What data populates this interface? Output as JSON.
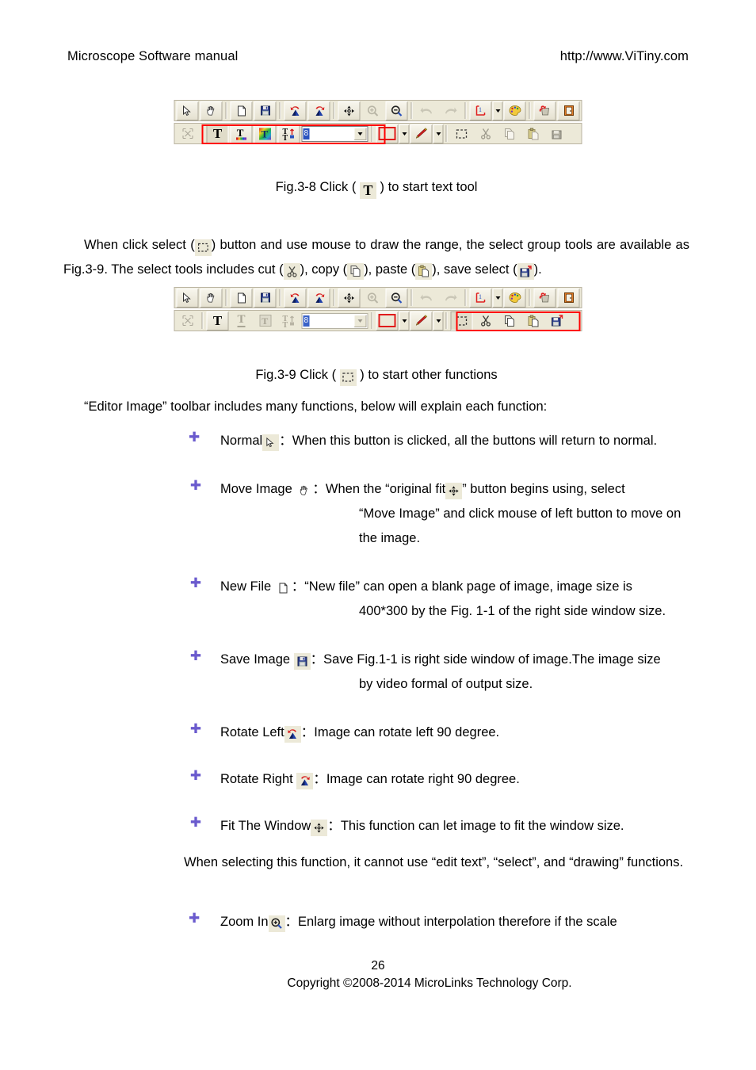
{
  "header": {
    "left": "Microscope Software manual",
    "right": "http://www.ViTiny.com"
  },
  "figures": [
    {
      "id": "fig-3-8",
      "caption_before": "Fig.3-8 Click (",
      "caption_icon": "text-tool-icon",
      "caption_after": ") to start text tool",
      "highlight": "text-tool-group"
    },
    {
      "id": "fig-3-9",
      "caption_before": "Fig.3-9 Click (",
      "caption_icon": "select-rectangle-icon",
      "caption_after": ") to start other functions",
      "highlight": "select-group"
    }
  ],
  "toolbar": {
    "row1": [
      {
        "name": "normal-cursor-button",
        "icon": "arrow-cursor-icon"
      },
      {
        "name": "move-image-button",
        "icon": "hand-icon"
      },
      {
        "name": "new-file-button",
        "icon": "new-page-icon"
      },
      {
        "name": "save-image-button",
        "icon": "floppy-disk-icon"
      },
      {
        "name": "rotate-left-button",
        "icon": "rotate-left-icon"
      },
      {
        "name": "rotate-right-button",
        "icon": "rotate-right-icon"
      },
      {
        "name": "fit-window-button",
        "icon": "fit-window-icon"
      },
      {
        "name": "zoom-in-button",
        "icon": "magnifier-plus-icon"
      },
      {
        "name": "zoom-out-button",
        "icon": "magnifier-minus-icon"
      },
      {
        "name": "undo-button",
        "icon": "undo-arrow-icon"
      },
      {
        "name": "redo-button",
        "icon": "redo-arrow-icon"
      },
      {
        "name": "measure-button",
        "icon": "measure-corner-icon"
      },
      {
        "name": "measure-dropdown",
        "icon": "chevron-down-icon"
      },
      {
        "name": "palette-button",
        "icon": "palette-icon"
      },
      {
        "name": "refresh-button",
        "icon": "recycle-bin-icon"
      },
      {
        "name": "exit-button",
        "icon": "exit-door-icon"
      }
    ],
    "row2": [
      {
        "name": "resize-button",
        "icon": "resize-arrows-icon"
      },
      {
        "name": "text-tool-button",
        "icon": "text-tool-icon"
      },
      {
        "name": "text-color-button",
        "icon": "text-rainbow-underline-icon"
      },
      {
        "name": "text-gradient-button",
        "icon": "text-gradient-icon"
      },
      {
        "name": "text-edit-button",
        "icon": "text-edit-icon"
      },
      {
        "name": "font-size-combo",
        "icon": "combo-box"
      },
      {
        "name": "fill-color-button",
        "icon": "color-swatch-icon"
      },
      {
        "name": "fill-color-dropdown",
        "icon": "chevron-down-icon"
      },
      {
        "name": "pencil-button",
        "icon": "pencil-icon"
      },
      {
        "name": "pencil-dropdown",
        "icon": "chevron-down-icon"
      },
      {
        "name": "select-button",
        "icon": "select-rectangle-icon"
      },
      {
        "name": "cut-button",
        "icon": "scissors-icon"
      },
      {
        "name": "copy-button",
        "icon": "copy-pages-icon"
      },
      {
        "name": "paste-button",
        "icon": "paste-clipboard-icon"
      },
      {
        "name": "save-select-button",
        "icon": "save-select-icon"
      }
    ],
    "font_size_value": "8"
  },
  "paragraphs": {
    "select_intro_1": "When click select (",
    "select_intro_2": ") button and use mouse to draw the range, the select group tools are available as Fig.3-9. The select tools includes cut (",
    "select_intro_3": "), copy (",
    "select_intro_4": "), paste (",
    "select_intro_5": "), save select (",
    "select_intro_6": ").",
    "editor_intro": "“Editor Image” toolbar includes many functions, below will explain each function:",
    "fit_window_note": "When selecting this function, it cannot use “edit text”, “select”, and “drawing” functions."
  },
  "functions": [
    {
      "label": "Normal",
      "icon": "arrow-cursor-icon",
      "colon": "：",
      "desc": "When this button is clicked, all the buttons will return to normal.",
      "sub": ""
    },
    {
      "label": "Move Image",
      "icon": "hand-icon",
      "colon": "：",
      "desc_pre": "When the “original fit",
      "desc_icon": "fit-window-icon",
      "desc_post": "” button begins using, select",
      "sub": "“Move Image” and click mouse of left button to move on the image."
    },
    {
      "label": "New File",
      "icon": "new-page-icon",
      "colon": "：",
      "desc": "“New file” can open a blank page of image, image size is",
      "sub": "400*300 by the Fig. 1-1 of the right side window size."
    },
    {
      "label": "Save Image",
      "icon": "floppy-disk-icon",
      "colon": "：",
      "desc": "Save Fig.1-1 is right side window of image.The image size",
      "sub": "by video formal of output size."
    },
    {
      "label": "Rotate Left",
      "icon": "rotate-left-icon",
      "colon": "：",
      "desc": "Image can rotate left 90 degree.",
      "sub": ""
    },
    {
      "label": "Rotate Right",
      "icon": "rotate-right-icon",
      "colon": "：",
      "desc": "Image can rotate right 90 degree.",
      "sub": ""
    },
    {
      "label": "Fit The Window",
      "icon": "fit-window-icon",
      "colon": "：",
      "desc": "This function can let image to fit the window size.",
      "sub": ""
    },
    {
      "label": "Zoom In",
      "icon": "magnifier-plus-icon",
      "colon": "：",
      "desc": "Enlarg image without interpolation therefore if the scale",
      "sub": ""
    }
  ],
  "footer": {
    "page_number": "26",
    "copyright": "Copyright ©2008-2014 MicroLinks Technology Corp."
  },
  "colors": {
    "toolbar_face": "#ece9d8",
    "highlight_red": "#ff0000",
    "bullet_purple": "#6a5acd",
    "selection_blue": "#2a52be"
  }
}
